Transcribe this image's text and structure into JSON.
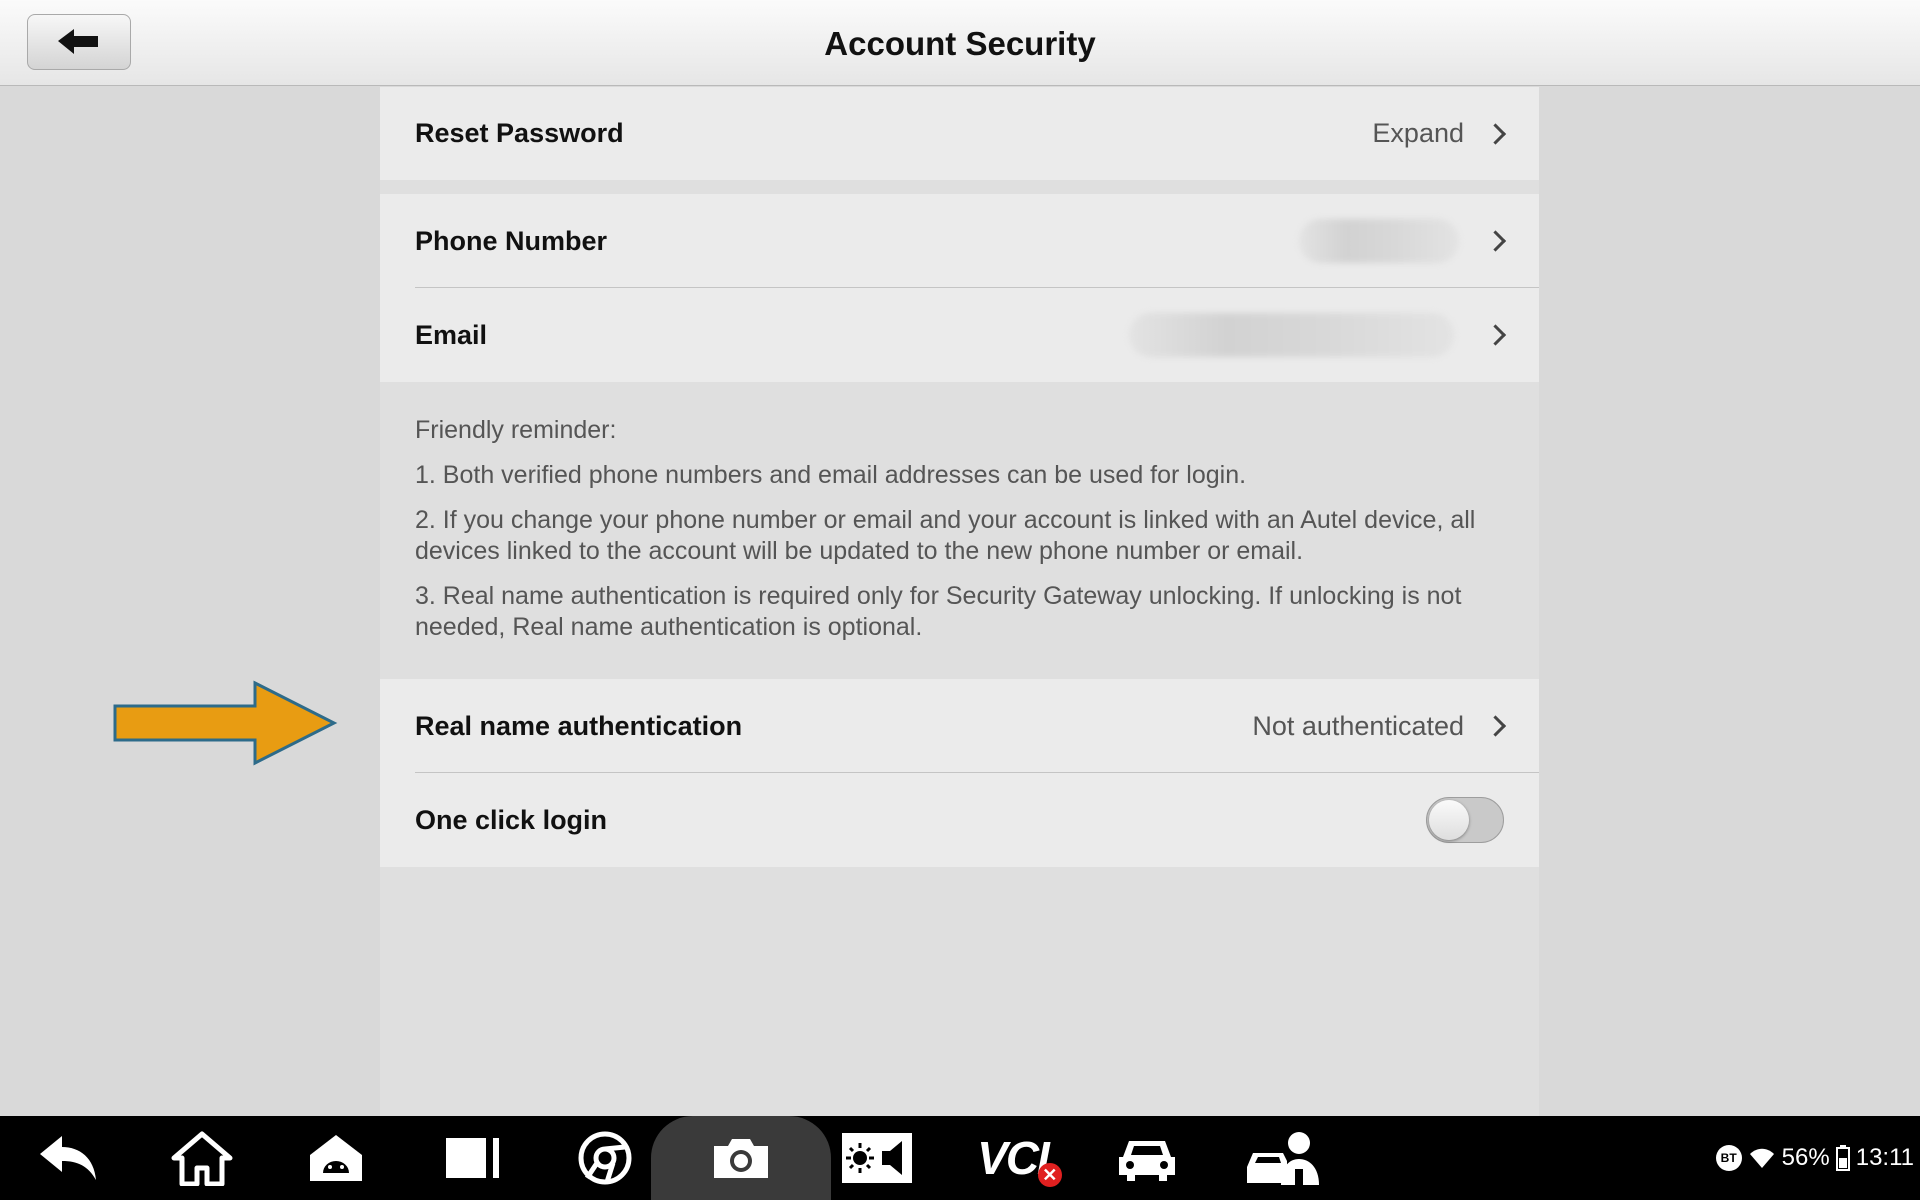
{
  "header": {
    "title": "Account Security",
    "back_icon": "back-arrow-icon"
  },
  "rows": {
    "reset_password": {
      "label": "Reset Password",
      "value": "Expand"
    },
    "phone_number": {
      "label": "Phone Number",
      "value_obscured": true
    },
    "email": {
      "label": "Email",
      "value_obscured": true
    },
    "real_name": {
      "label": "Real name authentication",
      "value": "Not authenticated"
    },
    "one_click": {
      "label": "One click login",
      "toggle_on": false
    }
  },
  "reminder": {
    "title": "Friendly reminder:",
    "items": [
      "1. Both verified phone numbers and email addresses can be used for login.",
      "2. If you change your phone number or email and your account is linked with an Autel device, all devices linked to the account will be updated to the new phone number or email.",
      "3. Real name authentication is required only for Security Gateway unlocking. If unlocking is not needed, Real name authentication is optional."
    ]
  },
  "annotation": {
    "arrow_color": "#e89c12",
    "arrow_stroke": "#2d6b8a"
  },
  "taskbar": {
    "icons": [
      "back-icon",
      "home-icon",
      "android-icon",
      "recent-apps-icon",
      "browser-icon",
      "camera-icon",
      "brightness-volume-icon",
      "vci-icon",
      "car-icon",
      "technician-icon"
    ],
    "vci_label": "VCI",
    "status": {
      "bt": "BT",
      "battery": "56%",
      "time": "13:11"
    }
  }
}
